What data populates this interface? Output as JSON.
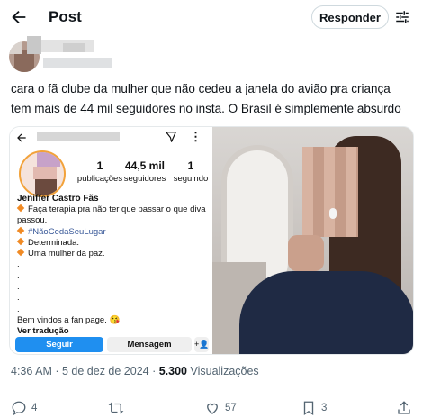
{
  "header": {
    "title": "Post",
    "reply_label": "Responder"
  },
  "tweet": {
    "text": "cara o fã clube da mulher que não cedeu a janela do avião pra criança tem mais de 44 mil seguidores no insta. O Brasil é simplemente absurdo",
    "time": "4:36 AM",
    "date": "5 de dez de 2024",
    "views_count": "5.300",
    "views_label": "Visualizações"
  },
  "instagram": {
    "stats": [
      {
        "num": "1",
        "label": "publicações"
      },
      {
        "num": "44,5 mil",
        "label": "seguidores"
      },
      {
        "num": "1",
        "label": "seguindo"
      }
    ],
    "name": "Jeniffer Castro Fãs",
    "bio": {
      "line1": "Faça terapia pra não ter que passar o que diva",
      "line2": "passou.",
      "hashtag": "#NãoCedaSeuLugar",
      "line4": "Determinada.",
      "line5": "Uma mulher da paz.",
      "dot": ".",
      "welcome": "Bem vindos a fan page. 😘",
      "translate": "Ver tradução"
    },
    "follow_label": "Seguir",
    "message_label": "Mensagem",
    "add_user_glyph": "+👤"
  },
  "actions": {
    "replies": "4",
    "reposts": "",
    "likes": "57",
    "bookmarks": "3"
  },
  "colors": {
    "accent": "#1d9bf0",
    "ig_follow": "#1f8ff0",
    "muted_text": "#536471"
  }
}
